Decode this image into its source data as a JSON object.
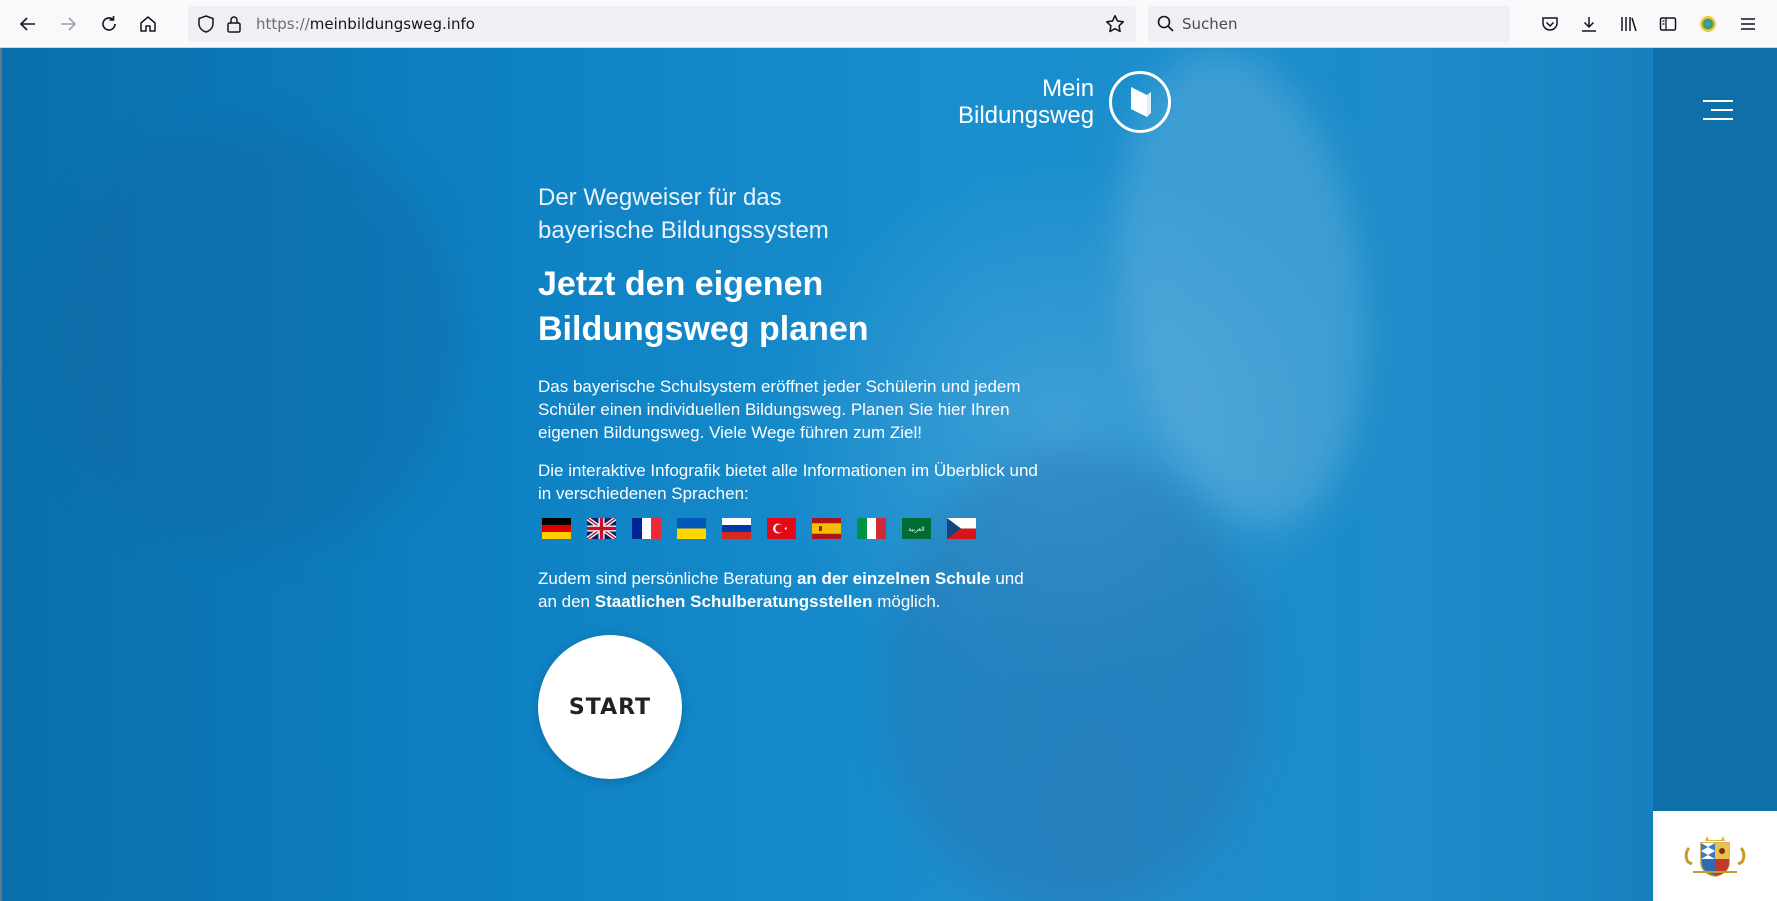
{
  "browser": {
    "url_protocol": "https://",
    "url_host": "meinbildungsweg.info",
    "search_placeholder": "Suchen"
  },
  "header": {
    "logo_line1": "Mein",
    "logo_line2": "Bildungsweg"
  },
  "hero": {
    "subtitle_line1": "Der Wegweiser für das",
    "subtitle_line2": "bayerische Bildungssystem",
    "headline_line1": "Jetzt den eigenen",
    "headline_line2": "Bildungsweg planen",
    "intro": "Das bayerische Schulsystem eröffnet jeder Schülerin und jedem Schüler einen individuellen Bildungsweg. Planen Sie hier Ihren eigenen Bildungsweg. Viele Wege führen zum Ziel!",
    "infographic": "Die interaktive Infografik bietet alle Informationen im Überblick und in verschiedenen Sprachen:",
    "advice_pre": "Zudem sind persönliche Beratung ",
    "advice_bold1": "an der einzelnen Schule",
    "advice_mid": " und an den ",
    "advice_bold2": "Staatlichen Schulberatungsstellen",
    "advice_post": " möglich.",
    "start_label": "START"
  },
  "flags": [
    {
      "icon": "germany-flag-icon"
    },
    {
      "icon": "uk-flag-icon"
    },
    {
      "icon": "france-flag-icon"
    },
    {
      "icon": "ukraine-flag-icon"
    },
    {
      "icon": "russia-flag-icon"
    },
    {
      "icon": "turkey-flag-icon"
    },
    {
      "icon": "spain-flag-icon"
    },
    {
      "icon": "italy-flag-icon"
    },
    {
      "icon": "arabic-flag-icon",
      "text": "العربية"
    },
    {
      "icon": "czech-flag-icon"
    }
  ],
  "colors": {
    "brand_blue": "#0e82c4",
    "side_panel": "#0f6fa8"
  }
}
